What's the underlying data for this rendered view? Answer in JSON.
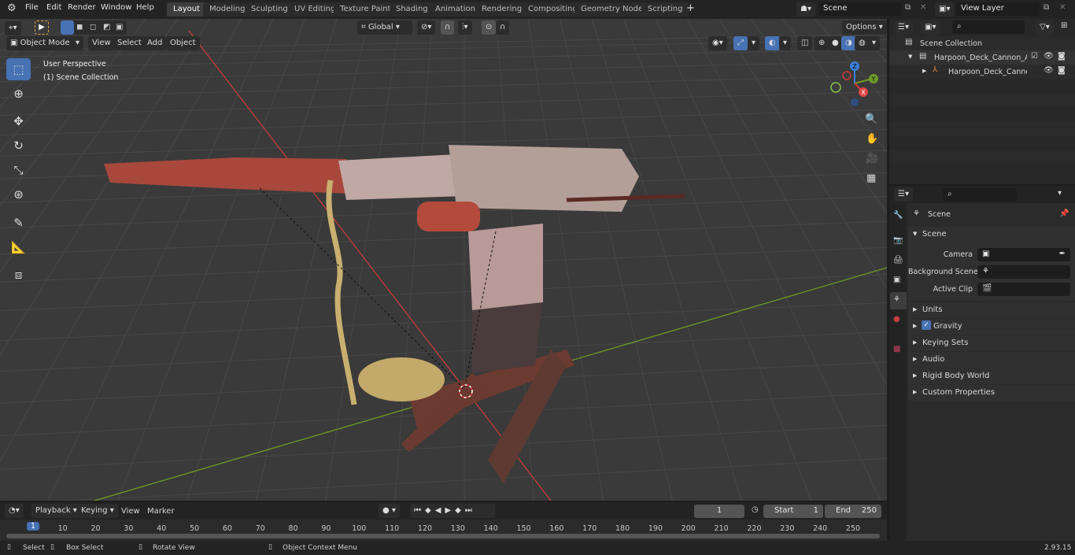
{
  "topbar": {
    "menus": [
      "File",
      "Edit",
      "Render",
      "Window",
      "Help"
    ],
    "workspaces": [
      "Layout",
      "Modeling",
      "Sculpting",
      "UV Editing",
      "Texture Paint",
      "Shading",
      "Animation",
      "Rendering",
      "Compositing",
      "Geometry Nodes",
      "Scripting"
    ],
    "active_workspace": "Layout",
    "scene": "Scene",
    "view_layer": "View Layer",
    "add_tab": "+"
  },
  "viewport_header": {
    "mode": "Object Mode",
    "menus": [
      "View",
      "Select",
      "Add",
      "Object"
    ],
    "transform_orientation": "Global",
    "options": "Options"
  },
  "viewport": {
    "view_name": "User Perspective",
    "collection": "(1) Scene Collection",
    "tools": [
      "select-box-icon",
      "cursor-icon",
      "move-icon",
      "rotate-icon",
      "scale-icon",
      "transform-icon",
      "annotate-icon",
      "measure-icon",
      "add-cube-icon"
    ],
    "axis_colors": {
      "x": "#c93a3a",
      "y": "#6f9a27",
      "z": "#3b7fd6"
    },
    "gizmo": {
      "x": "X",
      "y": "Y",
      "z": "Z"
    }
  },
  "outliner": {
    "root": "Scene Collection",
    "items": [
      {
        "name": "Harpoon_Deck_Cannon_Agec"
      },
      {
        "name": "Harpoon_Deck_Cannon_/"
      }
    ]
  },
  "properties": {
    "title": "Scene",
    "section": "Scene",
    "fields": [
      {
        "label": "Camera",
        "value": ""
      },
      {
        "label": "Background Scene",
        "value": ""
      },
      {
        "label": "Active Clip",
        "value": ""
      }
    ],
    "panels": [
      "Units",
      "Gravity",
      "Keying Sets",
      "Audio",
      "Rigid Body World",
      "Custom Properties"
    ],
    "gravity_checked": true
  },
  "timeline": {
    "menus": [
      "Playback",
      "Keying",
      "View",
      "Marker"
    ],
    "current_frame": "1",
    "start_label": "Start",
    "start": "1",
    "end_label": "End",
    "end": "250",
    "ticks": [
      "1",
      "10",
      "20",
      "30",
      "40",
      "50",
      "60",
      "70",
      "80",
      "90",
      "100",
      "110",
      "120",
      "130",
      "140",
      "150",
      "160",
      "170",
      "180",
      "190",
      "200",
      "210",
      "220",
      "230",
      "240",
      "250"
    ]
  },
  "status": {
    "select": "Select",
    "box_select": "Box Select",
    "rotate": "Rotate View",
    "context": "Object Context Menu",
    "version": "2.93.15"
  }
}
